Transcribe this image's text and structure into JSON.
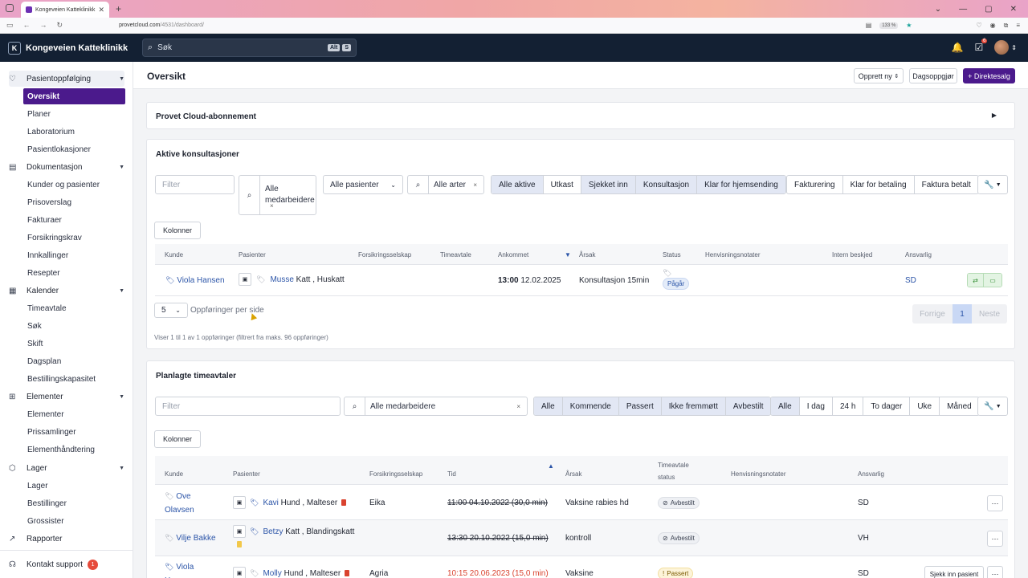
{
  "browser": {
    "tab_title": "Kongeveien Katteklinikk",
    "url_host": "provetcloud.com",
    "url_path": "/4531/dashboard/",
    "zoom": "133 %"
  },
  "header": {
    "logo_letter": "K",
    "clinic_name": "Kongeveien Katteklinikk",
    "search_placeholder": "Søk",
    "kbd": [
      "Alt",
      "S"
    ],
    "tasks_count": "6"
  },
  "sidebar": {
    "groups": [
      {
        "label": "Pasientoppfølging",
        "items": [
          "Oversikt",
          "Planer",
          "Laboratorium",
          "Pasientlokasjoner"
        ]
      },
      {
        "label": "Dokumentasjon",
        "items": [
          "Kunder og pasienter",
          "Prisoverslag",
          "Fakturaer",
          "Forsikringskrav",
          "Innkallinger",
          "Resepter"
        ]
      },
      {
        "label": "Kalender",
        "items": [
          "Timeavtale",
          "Søk",
          "Skift",
          "Dagsplan",
          "Bestillingskapasitet"
        ]
      },
      {
        "label": "Elementer",
        "items": [
          "Elementer",
          "Prissamlinger",
          "Elementhåndtering"
        ]
      },
      {
        "label": "Lager",
        "items": [
          "Lager",
          "Bestillinger",
          "Grossister"
        ]
      },
      {
        "label": "Rapporter",
        "items": []
      }
    ],
    "support_label": "Kontakt support",
    "support_count": "1"
  },
  "topbar": {
    "title": "Oversikt",
    "create_new": "Opprett ny",
    "day_settlement": "Dagsoppgjør",
    "direct_sale": "+ Direktesalg"
  },
  "subscription": {
    "title": "Provet Cloud-abonnement"
  },
  "active": {
    "title": "Aktive konsultasjoner",
    "filter_placeholder": "Filter",
    "staff": "Alle medarbeidere",
    "patients": "Alle pasienter",
    "species": "Alle arter",
    "status_filters": [
      "Alle aktive",
      "Utkast",
      "Sjekket inn",
      "Konsultasjon",
      "Klar for hjemsending"
    ],
    "billing_filters": [
      "Fakturering",
      "Klar for betaling",
      "Faktura betalt"
    ],
    "columns_btn": "Kolonner",
    "headers": [
      "Kunde",
      "Pasienter",
      "Forsikringsselskap",
      "Timeavtale",
      "Ankommet",
      "Årsak",
      "Status",
      "Henvisningsnotater",
      "Intern beskjed",
      "Ansvarlig"
    ],
    "row": {
      "customer": "Viola Hansen",
      "patient_name": "Musse",
      "patient_rest": "Katt , Huskatt",
      "arrived_time": "13:00",
      "arrived_date": "12.02.2025",
      "reason": "Konsultasjon 15min",
      "status": "Pågår",
      "responsible": "SD"
    },
    "per_page": "5",
    "per_page_label": "Oppføringer per side",
    "prev": "Forrige",
    "page": "1",
    "next": "Neste",
    "summary": "Viser 1 til 1 av 1 oppføringer (filtrert fra maks. 96 oppføringer)"
  },
  "planned": {
    "title": "Planlagte timeavtaler",
    "filter_placeholder": "Filter",
    "staff": "Alle medarbeidere",
    "status_filters": [
      "Alle",
      "Kommende",
      "Passert",
      "Ikke fremmøtt",
      "Avbestilt"
    ],
    "period_filters": [
      "Alle",
      "I dag",
      "24 h",
      "To dager",
      "Uke",
      "Måned"
    ],
    "columns_btn": "Kolonner",
    "headers": [
      "Kunde",
      "Pasienter",
      "Forsikringsselskap",
      "Tid",
      "Årsak",
      "Timeavtale status",
      "Henvisningsnotater",
      "Ansvarlig"
    ],
    "rows": [
      {
        "customer": "Ove Olavsen",
        "patient_name": "Kavi",
        "patient_rest": "Hund , Malteser",
        "insurer": "Eika",
        "time": "11:00 04.10.2022 (30,0 min)",
        "reason": "Vaksine rabies hd",
        "status": "Avbestilt",
        "responsible": "SD"
      },
      {
        "customer": "Vilje Bakke",
        "patient_name": "Betzy",
        "patient_rest": "Katt , Blandingskatt",
        "insurer": "",
        "time": "13:30 20.10.2022 (15,0 min)",
        "reason": "kontroll",
        "status": "Avbestilt",
        "responsible": "VH"
      },
      {
        "customer": "Viola Hansen",
        "patient_name": "Molly",
        "patient_rest": "Hund , Malteser",
        "insurer": "Agria",
        "time": "10:15 20.06.2023 (15,0 min)",
        "reason": "Vaksine",
        "status": "Passert",
        "responsible": "SD",
        "action": "Sjekk inn pasient"
      }
    ]
  },
  "colors": {
    "brand": "#4b1a8c",
    "header": "#132033",
    "link": "#2c55a8"
  }
}
